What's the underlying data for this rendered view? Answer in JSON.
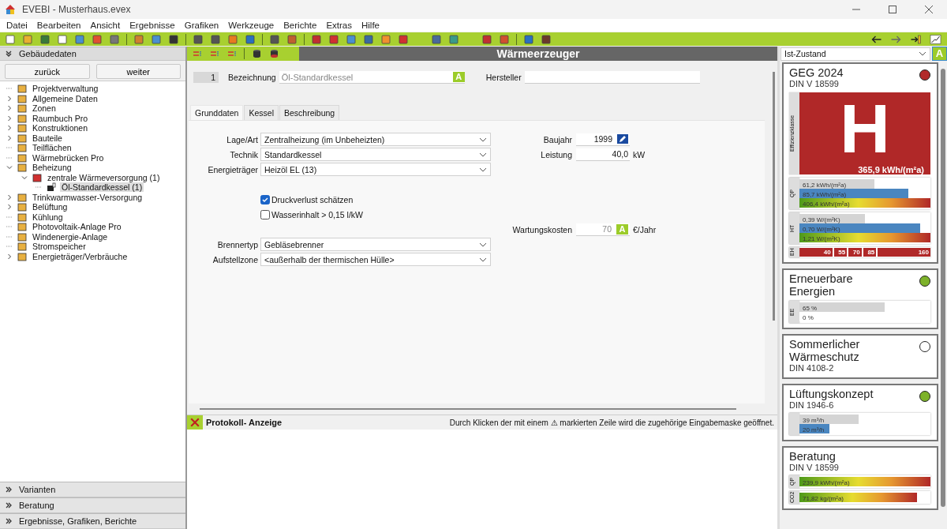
{
  "window": {
    "title": "EVEBI - Musterhaus.evex"
  },
  "menu": [
    "Datei",
    "Bearbeiten",
    "Ansicht",
    "Ergebnisse",
    "Grafiken",
    "Werkzeuge",
    "Berichte",
    "Extras",
    "Hilfe"
  ],
  "sidebar": {
    "header": "Gebäudedaten",
    "buttons": [
      "zurück",
      "weiter"
    ],
    "tree": [
      {
        "label": "Projektverwaltung",
        "expandable": false,
        "selected": false
      },
      {
        "label": "Allgemeine Daten",
        "expandable": true,
        "expanded": false,
        "selected": false
      },
      {
        "label": "Zonen",
        "expandable": true,
        "expanded": false,
        "selected": false
      },
      {
        "label": "Raumbuch Pro",
        "expandable": true,
        "expanded": false,
        "selected": false
      },
      {
        "label": "Konstruktionen",
        "expandable": true,
        "expanded": false,
        "selected": false
      },
      {
        "label": "Bauteile",
        "expandable": true,
        "expanded": false,
        "selected": false
      },
      {
        "label": "Teilflächen",
        "expandable": false,
        "selected": false
      },
      {
        "label": "Wärmebrücken Pro",
        "expandable": false,
        "selected": false
      },
      {
        "label": "Beheizung",
        "expandable": true,
        "expanded": true,
        "selected": false,
        "children": [
          {
            "label": "zentrale Wärmeversorgung (1)",
            "expandable": true,
            "expanded": true,
            "selected": false,
            "children": [
              {
                "label": "Öl-Standardkessel (1)",
                "expandable": false,
                "selected": true
              }
            ]
          }
        ]
      },
      {
        "label": "Trinkwarmwasser-Versorgung",
        "expandable": true,
        "expanded": false,
        "selected": false
      },
      {
        "label": "Belüftung",
        "expandable": true,
        "expanded": false,
        "selected": false
      },
      {
        "label": "Kühlung",
        "expandable": false,
        "selected": false
      },
      {
        "label": "Photovoltaik-Anlage Pro",
        "expandable": false,
        "selected": false
      },
      {
        "label": "Windenergie-Anlage",
        "expandable": false,
        "selected": false
      },
      {
        "label": "Stromspeicher",
        "expandable": false,
        "selected": false
      },
      {
        "label": "Energieträger/Verbräuche",
        "expandable": true,
        "expanded": false,
        "selected": false
      }
    ],
    "sections": [
      "Varianten",
      "Beratung",
      "Ergebnisse, Grafiken, Berichte"
    ]
  },
  "editor": {
    "title": "Wärmeerzeuger",
    "number": "1",
    "name_label": "Bezeichnung",
    "name_value": "Öl-Standardkessel",
    "name_button": "A",
    "maker_label": "Hersteller",
    "tabs": [
      {
        "label": "Grunddaten",
        "selected": true
      },
      {
        "label": "Kessel",
        "selected": false
      },
      {
        "label": "Beschreibung",
        "selected": false
      }
    ],
    "rows": [
      {
        "left": {
          "kind": "select",
          "label": "Lage/Art",
          "value": "Zentralheizung (im Unbeheizten)"
        },
        "right": {
          "kind": "number",
          "label": "Baujahr",
          "value": "1999",
          "edit_icon": true
        }
      },
      {
        "left": {
          "kind": "select",
          "label": "Technik",
          "value": "Standardkessel"
        },
        "right": {
          "kind": "number",
          "label": "Leistung",
          "value": "40,0",
          "unit": "kW"
        }
      },
      {
        "left": {
          "kind": "select",
          "label": "Energieträger",
          "value": "Heizöl EL (13)"
        }
      },
      {
        "left": {
          "kind": "checkbox",
          "label": "Druckverlust schätzen",
          "checked": true
        }
      },
      {
        "left": {
          "kind": "checkbox",
          "label": "Wasserinhalt > 0,15 l/kW",
          "checked": false
        }
      },
      {
        "right": {
          "kind": "number",
          "label": "Wartungskosten",
          "value": "70",
          "button": "A",
          "unit": "€/Jahr"
        }
      },
      {
        "left": {
          "kind": "select",
          "label": "Brennertyp",
          "value": "Gebläsebrenner"
        }
      },
      {
        "left": {
          "kind": "select",
          "label": "Aufstellzone",
          "value": "<außerhalb der thermischen Hülle>"
        }
      }
    ]
  },
  "protocol": {
    "title": "Protokoll- Anzeige",
    "message": "Durch Klicken der mit einem ⚠ markierten Zeile wird die zugehörige Eingabemaske geöffnet."
  },
  "results": {
    "variant": "Ist-Zustand",
    "variant_button": "A",
    "cards": [
      {
        "title": "GEG 2024",
        "subtitle": "DIN V 18599",
        "color": "#b22a2a",
        "rating": {
          "label": "Effizienzklasse",
          "class": "H",
          "value": "365,9 kWh/(m²a)"
        },
        "groups": [
          {
            "label": "QP",
            "bars": [
              {
                "kind": "grey",
                "text": "61,2 kWh/(m²a)",
                "level": 0.57
              },
              {
                "kind": "blue",
                "text": "85,7 kWh/(m²a)",
                "level": 0.83
              },
              {
                "kind": "gradient",
                "text": "406,4 kWh/(m²a)",
                "level": 1
              }
            ]
          },
          {
            "label": "HT",
            "bars": [
              {
                "kind": "grey",
                "text": "0,39 W/(m²K)",
                "level": 0.5
              },
              {
                "kind": "blue",
                "text": "0,70 W/(m²K)",
                "level": 0.92
              },
              {
                "kind": "gradient",
                "text": "1,21 W/(m²K)",
                "level": 1
              }
            ]
          }
        ],
        "scale": {
          "label": "EH",
          "marks": [
            "40",
            "55",
            "70",
            "85",
            "160"
          ]
        }
      },
      {
        "title": "Erneuerbare Energien",
        "color": "#7db22a",
        "groups": [
          {
            "label": "EE",
            "bars": [
              {
                "kind": "grey",
                "text": "65 %",
                "level": 0.65
              },
              {
                "kind": "white",
                "text": "0 %",
                "level": 0
              }
            ]
          }
        ]
      },
      {
        "title": "Sommerlicher Wärmeschutz",
        "subtitle": "DIN 4108-2",
        "color": "#ffffff"
      },
      {
        "title": "Lüftungskonzept",
        "subtitle": "DIN 1946-6",
        "color": "#7db22a",
        "groups": [
          {
            "bars": [
              {
                "kind": "grey",
                "text": "39 m³/h",
                "level": 0.45
              },
              {
                "kind": "blue",
                "text": "20 m³/h",
                "level": 0.23
              }
            ]
          }
        ]
      },
      {
        "title": "Beratung",
        "subtitle": "DIN V 18599",
        "groups": [
          {
            "label": "QP",
            "bars": [
              {
                "kind": "gradient",
                "text": "239,9 kWh/(m²a)",
                "level": 1
              }
            ]
          },
          {
            "label": "CO2",
            "bars": [
              {
                "kind": "gradient",
                "text": "71,82 kg/(m²a)",
                "level": 0.9
              }
            ]
          }
        ]
      }
    ]
  }
}
